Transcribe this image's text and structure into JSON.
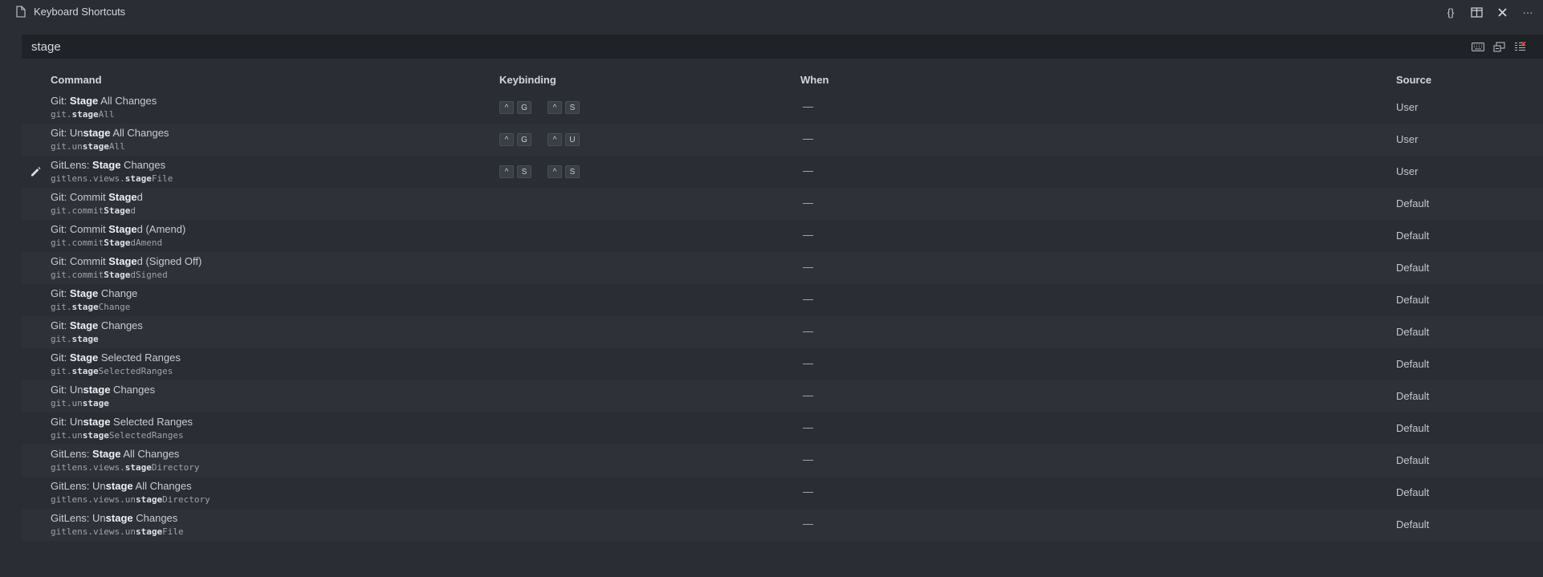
{
  "tab": {
    "title": "Keyboard Shortcuts",
    "icon": "file-icon"
  },
  "actions": [
    {
      "name": "open-json-button",
      "label": "{}"
    },
    {
      "name": "split-editor-button",
      "icon": "split-editor-icon"
    },
    {
      "name": "close-button",
      "icon": "close-icon"
    },
    {
      "name": "more-actions-button",
      "label": "···"
    }
  ],
  "search": {
    "value": "stage",
    "placeholder": ""
  },
  "columns": {
    "command": "Command",
    "keybinding": "Keybinding",
    "when": "When",
    "source": "Source"
  },
  "rows": [
    {
      "title_pre": "Git: ",
      "title_match": "Stage",
      "title_post": " All Changes",
      "id_pre": "git.",
      "id_match": "stage",
      "id_post": "All",
      "keys": [
        "^",
        "G",
        "^",
        "S"
      ],
      "when": "—",
      "source": "User"
    },
    {
      "title_pre": "Git: Un",
      "title_match": "stage",
      "title_post": " All Changes",
      "id_pre": "git.un",
      "id_match": "stage",
      "id_post": "All",
      "keys": [
        "^",
        "G",
        "^",
        "U"
      ],
      "when": "—",
      "source": "User"
    },
    {
      "title_pre": "GitLens: ",
      "title_match": "Stage",
      "title_post": " Changes",
      "id_pre": "gitlens.views.",
      "id_match": "stage",
      "id_post": "File",
      "keys": [
        "^",
        "S",
        "^",
        "S"
      ],
      "when": "—",
      "source": "User"
    },
    {
      "title_pre": "Git: Commit ",
      "title_match": "Stage",
      "title_post": "d",
      "id_pre": "git.commit",
      "id_match": "Stage",
      "id_post": "d",
      "keys": [],
      "when": "—",
      "source": "Default"
    },
    {
      "title_pre": "Git: Commit ",
      "title_match": "Stage",
      "title_post": "d (Amend)",
      "id_pre": "git.commit",
      "id_match": "Stage",
      "id_post": "dAmend",
      "keys": [],
      "when": "—",
      "source": "Default"
    },
    {
      "title_pre": "Git: Commit ",
      "title_match": "Stage",
      "title_post": "d (Signed Off)",
      "id_pre": "git.commit",
      "id_match": "Stage",
      "id_post": "dSigned",
      "keys": [],
      "when": "—",
      "source": "Default"
    },
    {
      "title_pre": "Git: ",
      "title_match": "Stage",
      "title_post": " Change",
      "id_pre": "git.",
      "id_match": "stage",
      "id_post": "Change",
      "keys": [],
      "when": "—",
      "source": "Default"
    },
    {
      "title_pre": "Git: ",
      "title_match": "Stage",
      "title_post": " Changes",
      "id_pre": "git.",
      "id_match": "stage",
      "id_post": "",
      "keys": [],
      "when": "—",
      "source": "Default"
    },
    {
      "title_pre": "Git: ",
      "title_match": "Stage",
      "title_post": " Selected Ranges",
      "id_pre": "git.",
      "id_match": "stage",
      "id_post": "SelectedRanges",
      "keys": [],
      "when": "—",
      "source": "Default"
    },
    {
      "title_pre": "Git: Un",
      "title_match": "stage",
      "title_post": " Changes",
      "id_pre": "git.un",
      "id_match": "stage",
      "id_post": "",
      "keys": [],
      "when": "—",
      "source": "Default"
    },
    {
      "title_pre": "Git: Un",
      "title_match": "stage",
      "title_post": " Selected Ranges",
      "id_pre": "git.un",
      "id_match": "stage",
      "id_post": "SelectedRanges",
      "keys": [],
      "when": "—",
      "source": "Default"
    },
    {
      "title_pre": "GitLens: ",
      "title_match": "Stage",
      "title_post": " All Changes",
      "id_pre": "gitlens.views.",
      "id_match": "stage",
      "id_post": "Directory",
      "keys": [],
      "when": "—",
      "source": "Default"
    },
    {
      "title_pre": "GitLens: Un",
      "title_match": "stage",
      "title_post": " All Changes",
      "id_pre": "gitlens.views.un",
      "id_match": "stage",
      "id_post": "Directory",
      "keys": [],
      "when": "—",
      "source": "Default"
    },
    {
      "title_pre": "GitLens: Un",
      "title_match": "stage",
      "title_post": " Changes",
      "id_pre": "gitlens.views.un",
      "id_match": "stage",
      "id_post": "File",
      "keys": [],
      "when": "—",
      "source": "Default"
    }
  ],
  "edit_row_index": 2,
  "colors": {
    "background": "#2a2d33",
    "row_alt": "#2e3137",
    "search_bg": "#1f2227"
  }
}
